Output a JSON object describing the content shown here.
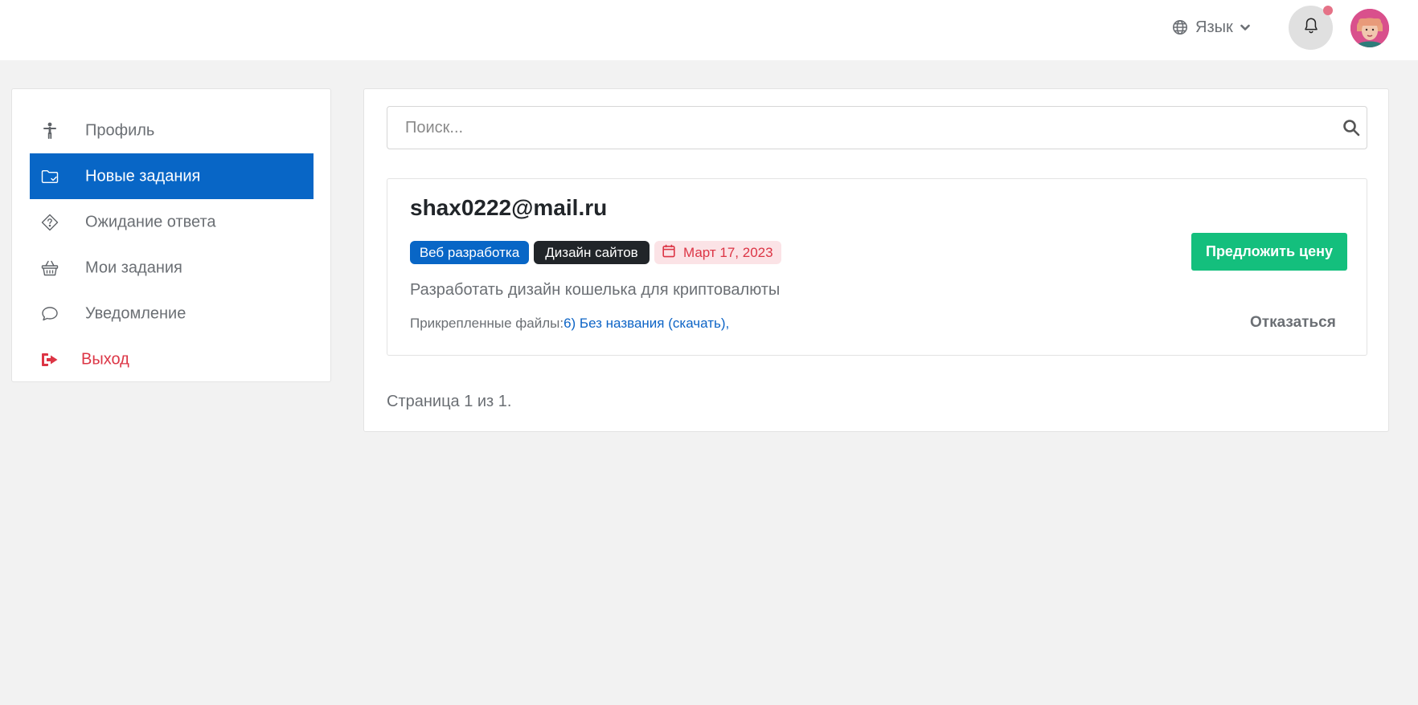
{
  "header": {
    "language_label": "Язык",
    "language_icon": "globe-icon",
    "notifications_icon": "bell-icon",
    "colors": {
      "notification_dot": "#e57287"
    }
  },
  "sidebar": {
    "items": [
      {
        "label": "Профиль",
        "icon": "person-icon",
        "active": false
      },
      {
        "label": "Новые задания",
        "icon": "folder-check-icon",
        "active": true
      },
      {
        "label": "Ожидание ответа",
        "icon": "question-tag-icon",
        "active": false
      },
      {
        "label": "Мои задания",
        "icon": "basket-icon",
        "active": false
      },
      {
        "label": "Уведомление",
        "icon": "chat-bubble-icon",
        "active": false
      },
      {
        "label": "Выход",
        "icon": "sign-out-icon",
        "active": false
      }
    ]
  },
  "search": {
    "placeholder": "Поиск...",
    "value": ""
  },
  "task": {
    "title": "shax0222@mail.ru",
    "tags": [
      "Веб разработка",
      "Дизайн сайтов"
    ],
    "date": "Март 17, 2023",
    "description": "Разработать дизайн кошелька для криптовалюты",
    "files_label": "Прикрепленные файлы:",
    "file_link": "6) Без названия (скачать),",
    "offer_button": "Предложить цену",
    "reject_button": "Отказаться"
  },
  "pagination": {
    "text": "Страница 1 из 1."
  },
  "colors": {
    "primary": "#0866c6",
    "success": "#14bf7d",
    "danger": "#dc3545",
    "dark": "#212529",
    "background": "#f2f2f2"
  }
}
